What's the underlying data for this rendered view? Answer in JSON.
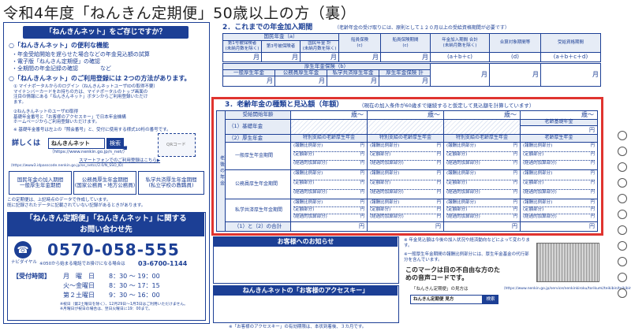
{
  "title": "令和4年度「ねんきん定期便」50歳以上の方（裏）",
  "left": {
    "header": "「ねんきんネット」をご存じですか？",
    "h_convenient": "○「ねんきんネット」の便利な機能",
    "features": [
      "・年金受給開始を遅らせた場合などの年金見込額の試算",
      "・電子版「ねんきん定期便」の確認",
      "・全期間の年金記録の確認　　　　など"
    ],
    "h_methods": "○「ねんきんネット」のご利用登録には 2つの方法があります。",
    "method1": "① マイナポータルからのログイン（ねんきんネットユーザIDの取得不要）\nマイナンバーカードをお持ちの方は、マイナポータルのトップ画面の\n注目の情報にある「ねんきんネット」ボタンからご利用登録いただけ\nます。",
    "method2": "②ねんきんネットのユーザID取得\n基礎年金番号と「お客様のアクセスキー」で日本年金機構\nホームページからご利用登録いただけます。",
    "note_access": "※ 基礎年金番号は左上の「照会番号」と、受付に使用する様式10桁の番号です。",
    "detail_label": "詳しくは",
    "search_text": "ねんきんネット",
    "search_btn": "検索",
    "url1": "（https://www.nenkin.go.jp/n_net/）",
    "qr_label": "QRコード",
    "phone_link": "スマートフォンでのご利用登録はこちら▶",
    "url2": "（https://www3.idpasscode.nenkin.go.jp/se_netcc/2.0/N_SSO_ID）",
    "grid_headers": [
      "国民年金の加入期間\n一般厚生年金期間",
      "公務員厚生年金期間\n(国家公務員・地方公務員)",
      "私学共済厚生年金期間\n(私立学校の教職員)"
    ],
    "note_bottom": "この定期便は、上記時点のデータで作成しています。\n既に記録されたデータに記載されていない記録があるときがあります。",
    "contact_title": "「ねんきん定期便」「ねんきんネット」に関する\nお問い合わせ先",
    "brand": "ナビダイヤル",
    "phone": "0570-058-555",
    "phone_note": "※050から始まる電話でお掛けになる場合は",
    "phone_alt": "03-6700-1144",
    "hours_label": "【受付時間】",
    "hours": [
      [
        "月　曜　日",
        "8：30 ～ 19：00"
      ],
      [
        "火～金曜日",
        "8：30 ～ 17：15"
      ],
      [
        "第２土曜日",
        "9：30 ～ 16：00"
      ]
    ],
    "hours_note": "※祝日（第2土曜日を除く）、12月29日～1月3日はご利用いただけません。\n※月曜日が祝日の場合は、翌日火曜日に19：00まで。"
  },
  "sec2": {
    "title": "2．これまでの年金加入期間",
    "subtitle": "（老齢年金の受け取りには、原則として１２０月以上の受給資格期間が必要です）",
    "kokumin": "国民年金（a）",
    "k_cols": [
      "第1号被保険者\n(未納月数を除く)",
      "第3号被保険者",
      "国民年金 計\n(未納月数を除く)"
    ],
    "ship": "船員保険\n(c)",
    "funin": "船員保険期間\n(c)",
    "kanyu": "年金加入期間 合計\n(未納月数を除く)",
    "gosan": "合算対象期間等",
    "jukyu": "受給資格期間",
    "k_formula": [
      "(a＋b＋c)",
      "(d)",
      "(a＋b＋c＋d)"
    ],
    "kosei": "厚生年金保険（b）",
    "kosei_cols": [
      "一般厚生年金",
      "公務員厚生年金",
      "私学共済厚生年金",
      "厚生年金保険 計"
    ],
    "unit": "月"
  },
  "sec3": {
    "title": "3．老齢年金の種類と見込額（年額）",
    "subtitle": "（現在の加入条件が60歳まで継続すると仮定して見込額を計算しています）",
    "start_age": "受給開始年齢",
    "age": "歳～",
    "row1": "（1）基礎年金",
    "basic_label": "老齢基礎年金",
    "row2": "（2）厚生年金",
    "side_label": "老後の年金",
    "col_headers": [
      "特別支給の老齢厚生年金",
      "特別支給の老齢厚生年金",
      "特別支給の老齢厚生年金",
      "老齢厚生年金"
    ],
    "sub_rows": [
      "一般厚生年金期間",
      "公務員厚生年金期間",
      "私学共済厚生年金期間"
    ],
    "items": [
      "(報酬比例部分)",
      "(定額部分)",
      "(経過的加算部分)"
    ],
    "total": "（1）と（2）の合計",
    "yen": "円"
  },
  "notice": {
    "title": "お客様へのお知らせ",
    "text1": "※ 年金見込額は今後の加入状況や経済動向などによって変わります。",
    "text2": "※一般厚生年金期間の報酬比例部分には、厚生年金基金の代行部分を含んでいます。",
    "code_text": "このマークは目の不自由な方のための音声コードです。",
    "access_label": "ねんきんネットの「お客様のアクセスキー」",
    "access_note": "※「お客様のアクセスキー」の有効期限は、本状到着後、３カ月です。",
    "howto": "「ねんきん定期便」の見方は",
    "howto_btn_text": "ねんきん定期便 見方",
    "howto_btn": "検索",
    "howto_url": "（https://www.nenkin.go.jp/service/nenkinkiroku/torikumi/teikibin/teikibin.html）"
  }
}
